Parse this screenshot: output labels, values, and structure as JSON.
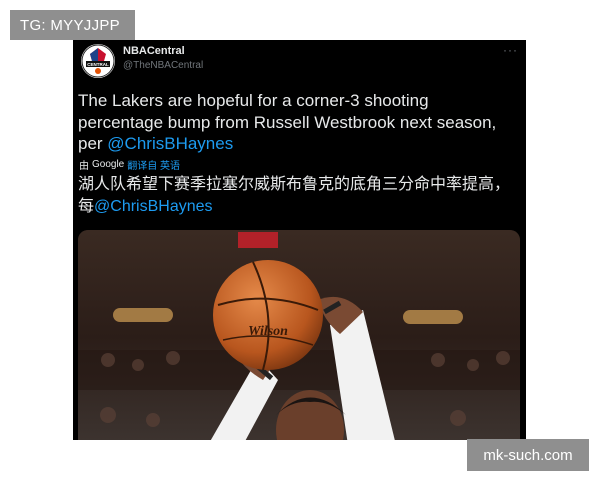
{
  "tag": "TG: MYYJJPP",
  "watermark": "mk-such.com",
  "tweet": {
    "display_name": "NBACentral",
    "handle": "@TheNBACentral",
    "more_glyph": "···",
    "avatar_logo_text": "CENTRAL",
    "text_main": "The Lakers are hopeful for a corner-3 shooting percentage bump from Russell Westbrook next season, per ",
    "text_mention": "@ChrisBHaynes",
    "translate_prefix": "由",
    "translate_brand": "Google",
    "translate_action": "翻译自 英语",
    "translated_main": "湖人队希望下赛季拉塞尔威斯布鲁克的底角三分命中率提高，每",
    "translated_mention": "@ChrisBHaynes"
  },
  "photo": {
    "ball_logo": "Wilson"
  }
}
